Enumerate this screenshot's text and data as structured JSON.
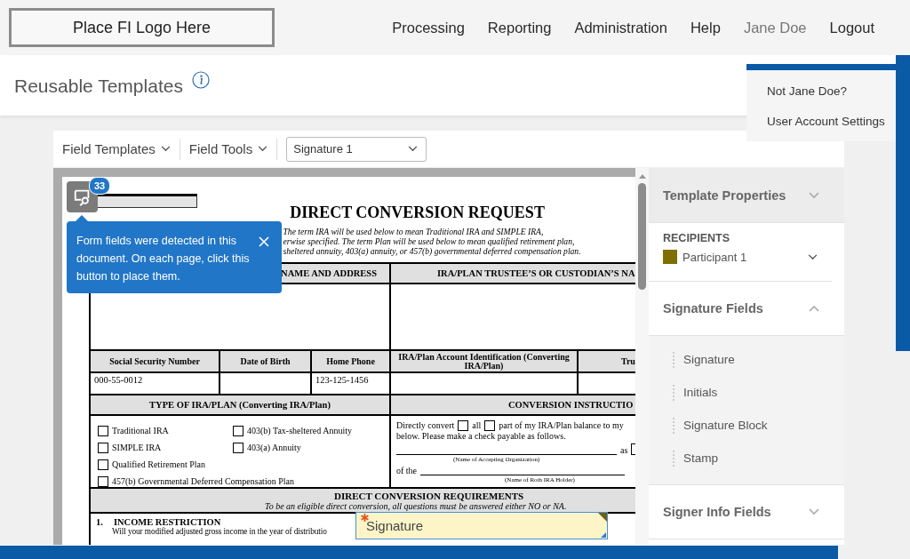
{
  "header": {
    "logo": "Place FI Logo Here",
    "nav": [
      {
        "label": "Processing",
        "selected": false
      },
      {
        "label": "Reporting",
        "selected": false
      },
      {
        "label": "Administration",
        "selected": false
      },
      {
        "label": "Help",
        "selected": false
      },
      {
        "label": "Jane Doe",
        "selected": true
      },
      {
        "label": "Logout",
        "selected": false
      }
    ]
  },
  "user_menu": {
    "items": [
      "Not Jane Doe?",
      "User Account Settings"
    ]
  },
  "page_title": "Reusable Templates",
  "toolbar": {
    "menus": [
      "Field Templates",
      "Field Tools"
    ],
    "field_select": {
      "value": "Signature 1"
    }
  },
  "document": {
    "form_title": "DIRECT CONVERSION REQUEST",
    "intro": [
      "The term IRA will be used below to mean Traditional IRA and SIMPLE IRA,",
      "erwise specified. The term Plan will be used below to mean qualified retirement plan,",
      "sheltered annuity, 403(a) annuity, or 457(b) governmental deferred compensation plan."
    ],
    "name_section": {
      "columns": [
        "NAME AND ADDRESS",
        "IRA/PLAN TRUSTEE’S OR CUSTODIAN’S NA"
      ]
    },
    "id_section": {
      "columns": [
        {
          "label": "Social Security Number",
          "value": "000-55-0012"
        },
        {
          "label": "Date of Birth"
        },
        {
          "label": "Home Phone",
          "value": "123-125-1456"
        },
        {
          "label": "IRA/Plan Account Identification (Converting IRA/Plan)"
        },
        {
          "label": "Tru"
        }
      ]
    },
    "type_section": {
      "heading": "TYPE OF IRA/PLAN (Converting IRA/Plan)",
      "column_1": [
        {
          "label": "Traditional IRA",
          "checked": false
        },
        {
          "label": "SIMPLE IRA",
          "checked": false
        },
        {
          "label": "Qualified Retirement Plan",
          "checked": false
        },
        {
          "label": "457(b) Governmental Deferred Compensation Plan",
          "checked": false
        }
      ],
      "column_2": [
        {
          "label": "403(b) Tax-sheltered Annuity",
          "checked": false
        },
        {
          "label": "403(a) Annuity",
          "checked": false
        }
      ]
    },
    "instructions": {
      "heading": "CONVERSION INSTRUCTIO",
      "lead": "Directly convert",
      "options": [
        {
          "label": "all",
          "checked": false
        },
        {
          "label": "part of my IRA/Plan balance to my",
          "checked": false
        }
      ],
      "line_2": "below. Please make a check payable as follows.",
      "as_label": "as",
      "as_option": {
        "checked": false
      },
      "organization_caption": "(Name of Accepting Organization)",
      "of_label": "of the",
      "holder_caption": "(Name of Roth IRA Holder)"
    },
    "requirements": {
      "heading": "DIRECT CONVERSION REQUIREMENTS",
      "subtitle": "To be an eligible direct conversion, all questions must be answered either NO or NA."
    },
    "income": {
      "number": "1.",
      "heading": "INCOME RESTRICTION",
      "text": "Will your modified adjusted gross income in the year of distributio"
    }
  },
  "field_detector": {
    "count": "33",
    "message": "Form fields were detected in this document. On each page, click this button to place them."
  },
  "placed_field": {
    "label": "Signature",
    "required": true
  },
  "panel": {
    "sections": [
      {
        "kind": "header",
        "title": "Template Properties",
        "expanded": false
      },
      {
        "kind": "recipients",
        "label": "RECIPIENTS",
        "recipient": {
          "name": "Participant 1",
          "color": "#7f6e00"
        }
      },
      {
        "kind": "fields",
        "title": "Signature Fields",
        "expanded": true,
        "items": [
          "Signature",
          "Initials",
          "Signature Block",
          "Stamp"
        ]
      },
      {
        "kind": "fields",
        "title": "Signer Info Fields",
        "expanded": false
      }
    ]
  }
}
